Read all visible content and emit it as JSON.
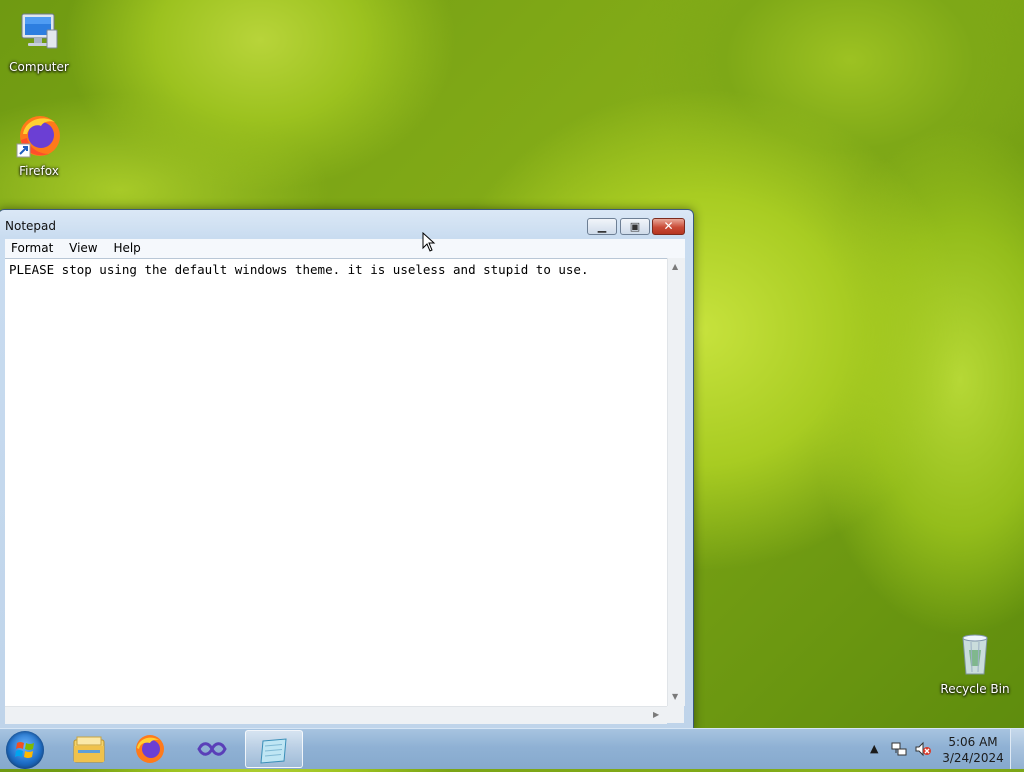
{
  "desktop": {
    "icons": [
      {
        "label": "Computer",
        "icon": "computer-icon"
      },
      {
        "label": "Firefox",
        "icon": "firefox-icon"
      },
      {
        "label": "Recycle Bin",
        "icon": "recycle-bin-icon"
      }
    ]
  },
  "notepad": {
    "title": "Notepad",
    "menu": [
      "Format",
      "View",
      "Help"
    ],
    "content": "PLEASE stop using the default windows theme. it is useless and stupid to use.",
    "buttons": {
      "minimize": "minimize",
      "maximize": "maximize",
      "close": "close"
    }
  },
  "taskbar": {
    "pinned": [
      "windows-explorer-icon",
      "firefox-icon",
      "visual-studio-icon",
      "notepad-icon"
    ],
    "active": "notepad-icon"
  },
  "tray": {
    "time": "5:06 AM",
    "date": "3/24/2024",
    "icons": [
      "show-hidden-icons-arrow",
      "network-icon",
      "volume-muted-icon"
    ]
  },
  "colors": {
    "accent": "#1f6fc7",
    "close_red": "#c94b37",
    "taskbar": "#8fb1d4"
  }
}
